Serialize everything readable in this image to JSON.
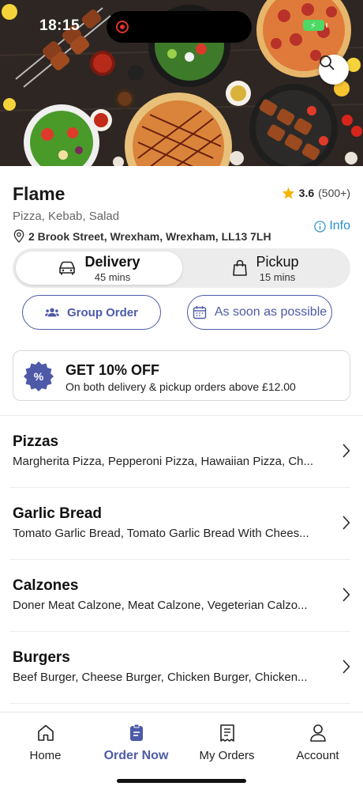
{
  "status_bar": {
    "time": "18:15"
  },
  "restaurant": {
    "name": "Flame",
    "rating": "3.6",
    "rating_count": "(500+)",
    "cuisines": "Pizza, Kebab, Salad",
    "address": "2 Brook Street, Wrexham, Wrexham, LL13 7LH",
    "info_label": "Info"
  },
  "order_mode": {
    "delivery": {
      "label": "Delivery",
      "time": "45 mins"
    },
    "pickup": {
      "label": "Pickup",
      "time": "15 mins"
    }
  },
  "actions": {
    "group_order": "Group Order",
    "schedule": "As soon as possible"
  },
  "promo": {
    "badge": "%",
    "title": "GET 10% OFF",
    "subtitle": "On both delivery & pickup orders above £12.00"
  },
  "categories": [
    {
      "title": "Pizzas",
      "items": "Margherita Pizza, Pepperoni Pizza, Hawaiian Pizza, Ch..."
    },
    {
      "title": "Garlic Bread",
      "items": "Tomato Garlic Bread, Tomato Garlic Bread With Chees..."
    },
    {
      "title": "Calzones",
      "items": "Doner Meat Calzone, Meat Calzone, Vegeterian Calzo..."
    },
    {
      "title": "Burgers",
      "items": "Beef Burger, Cheese Burger, Chicken Burger, Chicken..."
    }
  ],
  "bottom_nav": [
    {
      "label": "Home",
      "icon": "home-icon"
    },
    {
      "label": "Order Now",
      "icon": "order-icon",
      "active": true
    },
    {
      "label": "My Orders",
      "icon": "receipt-icon"
    },
    {
      "label": "Account",
      "icon": "user-icon"
    }
  ],
  "colors": {
    "accent": "#4e5aa8",
    "link": "#2a8fc9",
    "star": "#f5b400",
    "battery": "#4cd964"
  }
}
